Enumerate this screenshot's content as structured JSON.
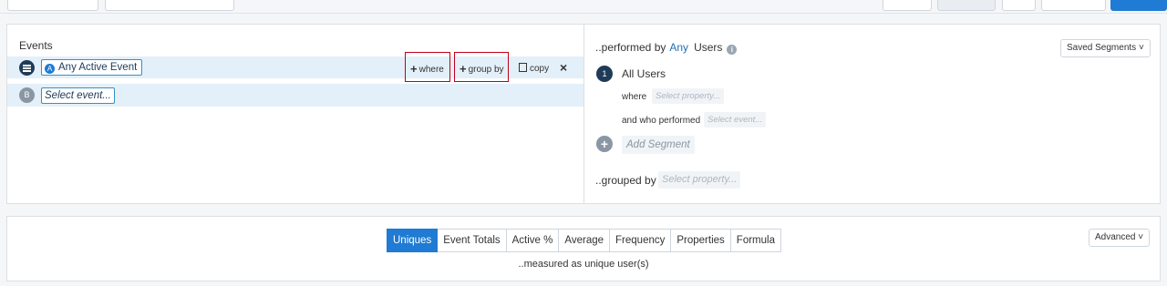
{
  "events_panel": {
    "title": "Events",
    "rows": [
      {
        "letter": "",
        "event": "Any Active Event"
      },
      {
        "letter": "B",
        "event": "Select event..."
      }
    ],
    "actions": {
      "where": "where",
      "group_by": "group by",
      "copy": "copy",
      "remove": "×"
    }
  },
  "segment_panel": {
    "performed_by": "..performed by",
    "any": "Any",
    "users": "Users",
    "saved_segments": "Saved Segments",
    "segment_number": "1",
    "segment_name": "All Users",
    "where_label": "where",
    "where_placeholder": "Select property...",
    "who_performed_label": "and who performed",
    "who_performed_placeholder": "Select event...",
    "add_segment": "Add Segment",
    "grouped_by": "..grouped by",
    "grouped_placeholder": "Select property..."
  },
  "metrics_panel": {
    "tabs": [
      "Uniques",
      "Event Totals",
      "Active %",
      "Average",
      "Frequency",
      "Properties",
      "Formula"
    ],
    "active_tab": "Uniques",
    "measured": "..measured as unique user(s)",
    "advanced": "Advanced"
  },
  "colors": {
    "accent": "#1f7bd3",
    "dark_navy": "#1f3b57",
    "highlight": "#c00018"
  }
}
